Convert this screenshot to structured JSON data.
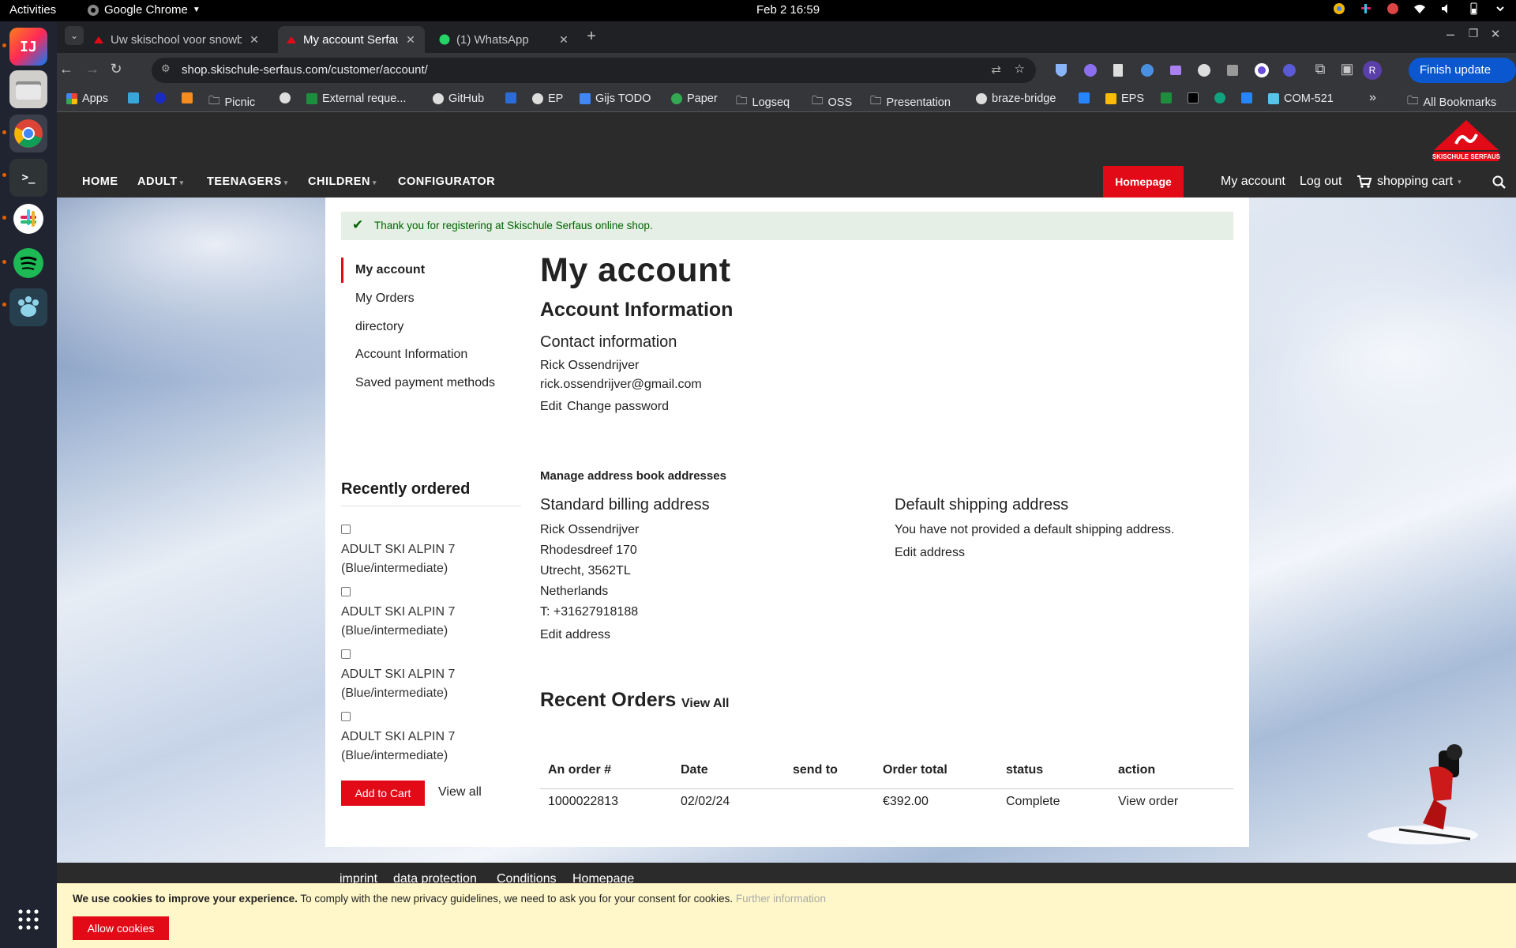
{
  "os": {
    "activities": "Activities",
    "app_name": "Google Chrome",
    "clock": "Feb 2  16:59"
  },
  "browser": {
    "tabs": [
      {
        "title": "Uw skischool voor snowboard"
      },
      {
        "title": "My account Serfaus Ski Sch"
      },
      {
        "title": "(1) WhatsApp"
      }
    ],
    "url": "shop.skischule-serfaus.com/customer/account/",
    "finish_update": "Finish update",
    "profile_initial": "R",
    "bookmarks": [
      "Apps",
      "Picnic",
      "External reque...",
      "GitHub",
      "EP",
      "Gijs TODO",
      "Paper",
      "Logseq",
      "OSS",
      "Presentation",
      "braze-bridge",
      "EPS",
      "COM-521"
    ],
    "all_bookmarks": "All Bookmarks",
    "overflow": "»"
  },
  "site": {
    "logo_text": "SKISCHULE SERFAUS",
    "nav": [
      "HOME",
      "ADULT",
      "TEENAGERS",
      "CHILDREN",
      "CONFIGURATOR"
    ],
    "homepage_btn": "Homepage",
    "my_account": "My account",
    "log_out": "Log out",
    "shopping_cart": "shopping cart",
    "notice": "Thank you for registering at Skischule Serfaus online shop.",
    "sidebar": [
      "My account",
      "My Orders",
      "directory",
      "Account Information",
      "Saved payment methods"
    ],
    "recently": {
      "title": "Recently ordered",
      "items": [
        "ADULT SKI ALPIN 7 (Blue/intermediate)",
        "ADULT SKI ALPIN 7 (Blue/intermediate)",
        "ADULT SKI ALPIN 7 (Blue/intermediate)",
        "ADULT SKI ALPIN 7 (Blue/intermediate)"
      ],
      "add_to_cart": "Add to Cart",
      "view_all": "View all"
    },
    "main": {
      "title": "My account",
      "account_info": "Account Information",
      "contact_title": "Contact information",
      "contact_name": "Rick Ossendrijver",
      "contact_email": "rick.ossendrijver@gmail.com",
      "edit": "Edit",
      "change_password": "Change password",
      "address_book": "Manage address book addresses",
      "billing_title": "Standard billing address",
      "billing_lines": [
        "Rick Ossendrijver",
        "Rhodesdreef 170",
        "Utrecht, 3562TL",
        "Netherlands",
        "T: +31627918188"
      ],
      "edit_address": "Edit address",
      "shipping_title": "Default shipping address",
      "shipping_text": "You have not provided a default shipping address.",
      "recent_orders": "Recent Orders",
      "view_all": "View All",
      "table": {
        "headers": [
          "An order #",
          "Date",
          "send to",
          "Order total",
          "status",
          "action"
        ],
        "row": [
          "1000022813",
          "02/02/24",
          "",
          "€392.00",
          "Complete",
          "View order"
        ]
      }
    },
    "footer": [
      "imprint",
      "data protection",
      "Conditions",
      "Homepage"
    ],
    "cookie": {
      "bold": "We use cookies to improve your experience.",
      "text": " To comply with the new privacy guidelines, we need to ask you for your consent for cookies. ",
      "more": "Further information",
      "button": "Allow cookies"
    }
  },
  "colors": {
    "brand_red": "#e20a16",
    "chrome_blue": "#0b57d0",
    "cookie_bg": "#fff7c9"
  }
}
